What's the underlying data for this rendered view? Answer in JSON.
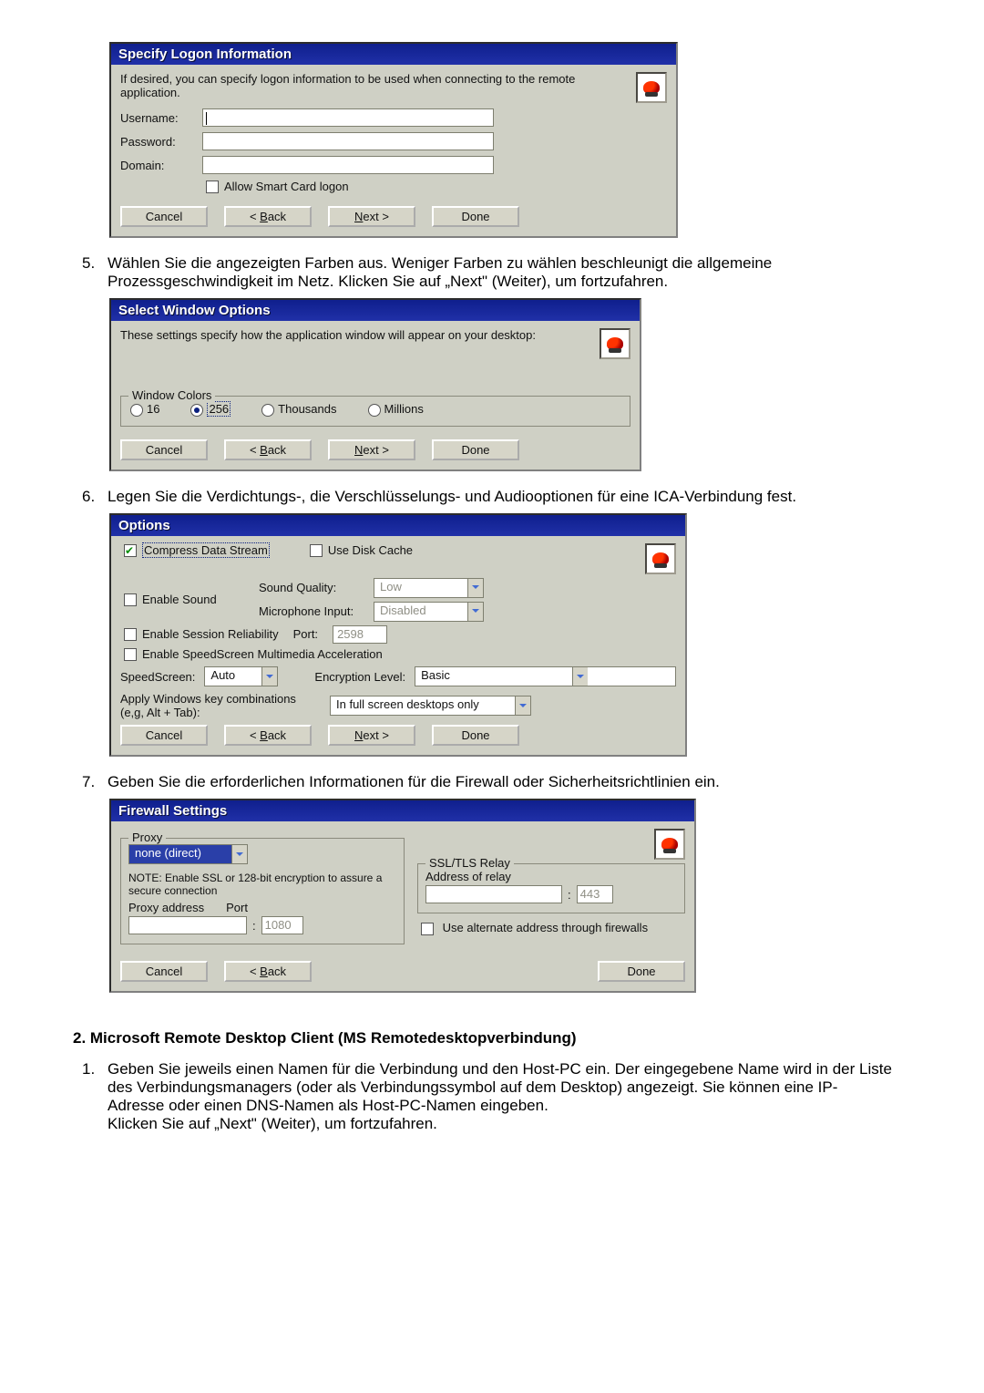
{
  "logon": {
    "title": "Specify Logon Information",
    "intro": "If desired, you can specify logon information to be used when connecting to the remote application.",
    "username_lbl": "Username:",
    "password_lbl": "Password:",
    "domain_lbl": "Domain:",
    "smartcard": "Allow Smart Card logon",
    "cancel": "Cancel",
    "back": "< Back",
    "next": "Next >",
    "done": "Done"
  },
  "step5": "Wählen Sie die angezeigten Farben aus. Weniger Farben zu wählen beschleunigt die allgemeine Prozessgeschwindigkeit im Netz. Klicken Sie auf „Next\" (Weiter), um fortzufahren.",
  "winopt": {
    "title": "Select Window Options",
    "intro": "These settings specify how the application window will appear on your desktop:",
    "legend": "Window Colors",
    "r16": "16",
    "r256": "256",
    "rthou": "Thousands",
    "rmill": "Millions",
    "cancel": "Cancel",
    "back": "< Back",
    "next": "Next >",
    "done": "Done"
  },
  "step6": "Legen Sie die Verdichtungs-, die Verschlüsselungs- und Audiooptionen für eine ICA-Verbindung fest.",
  "opt": {
    "title": "Options",
    "compress": "Compress Data Stream",
    "usecache": "Use Disk Cache",
    "enablesnd": "Enable Sound",
    "sq_lbl": "Sound Quality:",
    "sq_val": "Low",
    "mic_lbl": "Microphone Input:",
    "mic_val": "Disabled",
    "sess": "Enable Session Reliability",
    "port_lbl": "Port:",
    "port_val": "2598",
    "speedscr": "Enable SpeedScreen Multimedia Acceleration",
    "ss_lbl": "SpeedScreen:",
    "ss_val": "Auto",
    "enc_lbl": "Encryption Level:",
    "enc_val": "Basic",
    "winkey_lbl": "Apply Windows key combinations (e,g, Alt + Tab):",
    "winkey_val": "In full screen desktops only",
    "cancel": "Cancel",
    "back": "< Back",
    "next": "Next >",
    "done": "Done"
  },
  "step7": "Geben Sie die erforderlichen Informationen für die Firewall oder Sicherheitsrichtlinien ein.",
  "fw": {
    "title": "Firewall Settings",
    "proxy_legend": "Proxy",
    "proxy_val": "none (direct)",
    "note": "NOTE: Enable SSL or 128-bit encryption to assure a secure connection",
    "paddr_lbl": "Proxy address",
    "pport_lbl": "Port",
    "pport_val": "1080",
    "relay_legend": "SSL/TLS Relay",
    "addr_of_relay": "Address of relay",
    "relay_port_val": "443",
    "alt_addr": "Use alternate address through firewalls",
    "cancel": "Cancel",
    "back": "< Back",
    "done": "Done"
  },
  "s2_heading": "2. Microsoft Remote Desktop Client (MS Remotedesktopverbindung)",
  "s2_step1": "Geben Sie jeweils einen Namen für die Verbindung und den Host-PC ein. Der eingegebene Name wird in der Liste des Verbindungsmanagers (oder als Verbindungssymbol auf dem Desktop) angezeigt. Sie können eine IP-Adresse oder einen DNS-Namen als Host-PC-Namen eingeben.\nKlicken Sie auf „Next\" (Weiter), um fortzufahren."
}
